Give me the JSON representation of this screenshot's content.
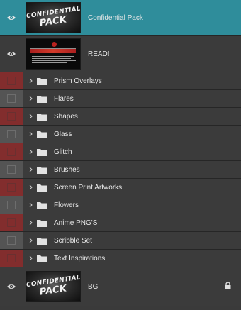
{
  "layers": {
    "top": [
      {
        "name": "Confidential Pack",
        "selected": true,
        "thumb_text": [
          "CONFIDENTIAL",
          "PACK"
        ]
      },
      {
        "name": "READ!",
        "selected": false
      }
    ],
    "groups": [
      {
        "name": "Prism Overlays",
        "color": "red"
      },
      {
        "name": "Flares",
        "color": "gray"
      },
      {
        "name": "Shapes",
        "color": "red"
      },
      {
        "name": "Glass",
        "color": "gray"
      },
      {
        "name": "Glitch",
        "color": "red"
      },
      {
        "name": "Brushes",
        "color": "gray"
      },
      {
        "name": "Screen Print Artworks",
        "color": "red"
      },
      {
        "name": "Flowers",
        "color": "gray"
      },
      {
        "name": "Anime PNG'S",
        "color": "red"
      },
      {
        "name": "Scribble Set",
        "color": "gray"
      },
      {
        "name": "Text Inspirations",
        "color": "red"
      }
    ],
    "bottom": {
      "name": "BG",
      "locked": true,
      "thumb_text": [
        "CONFIDENTIAL",
        "PACK"
      ]
    }
  },
  "icons": {
    "visibility": "eye-icon",
    "expand": "chevron-right-icon",
    "group": "folder-icon",
    "lock": "lock-icon"
  },
  "colors": {
    "selected_row": "#2f8d9b",
    "row": "#3b3b3b",
    "red_label": "#822d2d",
    "gray_label": "#545454"
  }
}
